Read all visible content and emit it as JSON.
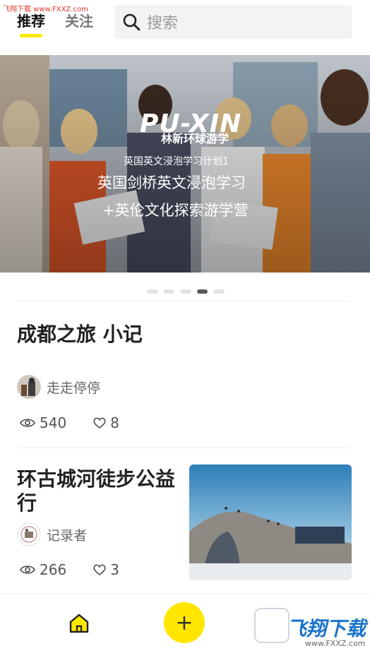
{
  "watermark_top": "飞翔下载 www.FXXZ.com",
  "header": {
    "tabs": [
      {
        "label": "推荐"
      },
      {
        "label": "关注"
      }
    ],
    "search_placeholder": "搜索"
  },
  "banner": {
    "logo": "PU-XIN",
    "logo_sub": "林新环球游学",
    "subtitle": "英国英文浸泡学习计划1",
    "line2": "英国剑桥英文浸泡学习",
    "line3": "+英伦文化探索游学营",
    "pager_count": 5,
    "pager_active": 3
  },
  "feed": [
    {
      "title": "成都之旅 小记",
      "author": "走走停停",
      "views": "540",
      "likes": "8"
    },
    {
      "title": "环古城河徒步公益行",
      "author": "记录者",
      "views": "266",
      "likes": "3"
    }
  ],
  "bottom_nav": {
    "add_label": "+",
    "watermark_text": "飞翔下载",
    "watermark_url": "www.FXXZ.com"
  },
  "colors": {
    "accent": "#ffe600",
    "watermark_red": "#e0352b",
    "watermark_blue": "#1a73c9"
  }
}
